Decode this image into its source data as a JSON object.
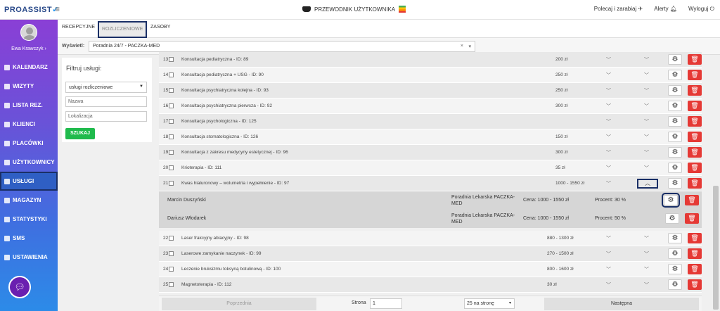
{
  "header": {
    "logo": "PROASSIST",
    "guide": "PRZEWODNIK UŻYTKOWNIKA",
    "refer": "Polecaj i zarabiaj",
    "alerts": "Alerty",
    "logout": "Wyloguj"
  },
  "user": {
    "name": "Ewa Krawczyk ›"
  },
  "nav": [
    {
      "label": "KALENDARZ"
    },
    {
      "label": "WIZYTY"
    },
    {
      "label": "LISTA REZ."
    },
    {
      "label": "KLIENCI"
    },
    {
      "label": "PLACÓWKI"
    },
    {
      "label": "UŻYTKOWNICY"
    },
    {
      "label": "USŁUGI"
    },
    {
      "label": "MAGAZYN"
    },
    {
      "label": "STATYSTYKI"
    },
    {
      "label": "SMS"
    },
    {
      "label": "USTAWIENIA"
    }
  ],
  "tabs": [
    "RECEPCYJNE",
    "ROZLICZENIOWE",
    "ZASOBY"
  ],
  "show": {
    "label": "Wyświetl:",
    "value": "Poradnia 24/7 - PACZKA-MED"
  },
  "filter": {
    "title": "Filtruj usługi:",
    "type": "usługi rozliczeniowe",
    "name_placeholder": "Nazwa",
    "location_placeholder": "Lokalizacja",
    "search": "SZUKAJ"
  },
  "rows": [
    {
      "num": "13",
      "name": "Konsultacja pediatryczna - ID: 89",
      "price": "200 zł"
    },
    {
      "num": "14",
      "name": "Konsultacja pediatryczna + USG - ID: 90",
      "price": "250 zł"
    },
    {
      "num": "15",
      "name": "Konsultacja psychiatryczna kolejna - ID: 93",
      "price": "250 zł"
    },
    {
      "num": "16",
      "name": "Konsultacja psychiatryczna pierwsza - ID: 92",
      "price": "300 zł"
    },
    {
      "num": "17",
      "name": "Konsultacja psychologiczna - ID: 125",
      "price": ""
    },
    {
      "num": "18",
      "name": "Konsultacja stomatologiczna - ID: 126",
      "price": "150 zł"
    },
    {
      "num": "19",
      "name": "Konsultacja z zakresu medycyny estetycznej - ID: 96",
      "price": "300 zł"
    },
    {
      "num": "20",
      "name": "Krioterapia - ID: 111",
      "price": "35 zł"
    },
    {
      "num": "21",
      "name": "Kwas hialuronowy – wolumetria i wypełnienie - ID: 97",
      "price": "1000 - 1550 zł"
    }
  ],
  "details": [
    {
      "name": "Marcin Duszyński",
      "place": "Poradnia Lekarska PACZKA-MED",
      "price": "Cena: 1000 - 1550 zł",
      "pct": "Procent: 30 %"
    },
    {
      "name": "Dariusz Włodarek",
      "place": "Poradnia Lekarska PACZKA-MED",
      "price": "Cena: 1000 - 1550 zł",
      "pct": "Procent: 50 %"
    }
  ],
  "rows2": [
    {
      "num": "22",
      "name": "Laser frakcyjny ablacyjny - ID: 98",
      "price": "880 - 1300 zł"
    },
    {
      "num": "23",
      "name": "Laserowe zamykanie naczynek - ID: 99",
      "price": "270 - 1500 zł"
    },
    {
      "num": "24",
      "name": "Leczenie bruksizmu toksyną botulinową - ID: 100",
      "price": "800 - 1600 zł"
    },
    {
      "num": "25",
      "name": "Magnetoterapia - ID: 112",
      "price": "30 zł"
    }
  ],
  "pager": {
    "prev": "Poprzednia",
    "page_label": "Strona",
    "page": "1",
    "per_page": "25 na stronę",
    "next": "Następna"
  }
}
